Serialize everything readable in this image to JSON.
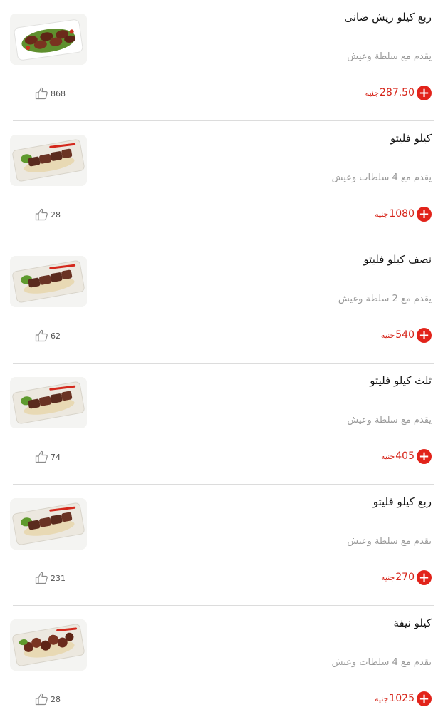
{
  "menu": {
    "items": [
      {
        "title": "ربع كيلو ريش ضانى",
        "description": "يقدم مع سلطة وعيش",
        "price": "287.50",
        "currency": "جنيه",
        "likes": "868",
        "image": "lamb-chops"
      },
      {
        "title": "كيلو فليتو",
        "description": "يقدم مع 4 سلطات وعيش",
        "price": "1080",
        "currency": "جنيه",
        "likes": "28",
        "image": "fillet-plate"
      },
      {
        "title": "نصف كيلو فليتو",
        "description": "يقدم مع 2 سلطة وعيش",
        "price": "540",
        "currency": "جنيه",
        "likes": "62",
        "image": "fillet-plate"
      },
      {
        "title": "ثلث كيلو فليتو",
        "description": "يقدم مع سلطة وعيش",
        "price": "405",
        "currency": "جنيه",
        "likes": "74",
        "image": "fillet-plate"
      },
      {
        "title": "ربع كيلو فليتو",
        "description": "يقدم مع سلطة وعيش",
        "price": "270",
        "currency": "جنيه",
        "likes": "231",
        "image": "fillet-plate"
      },
      {
        "title": "كيلو نيفة",
        "description": "يقدم مع 4 سلطات وعيش",
        "price": "1025",
        "currency": "جنيه",
        "likes": "28",
        "image": "nifa-plate"
      }
    ],
    "icons": {
      "add": "plus-icon",
      "like": "thumbs-up-icon"
    },
    "colors": {
      "accent": "#e2231a",
      "price": "#d62318",
      "muted": "#9a9a9a",
      "divider": "#dcdcdc"
    }
  }
}
